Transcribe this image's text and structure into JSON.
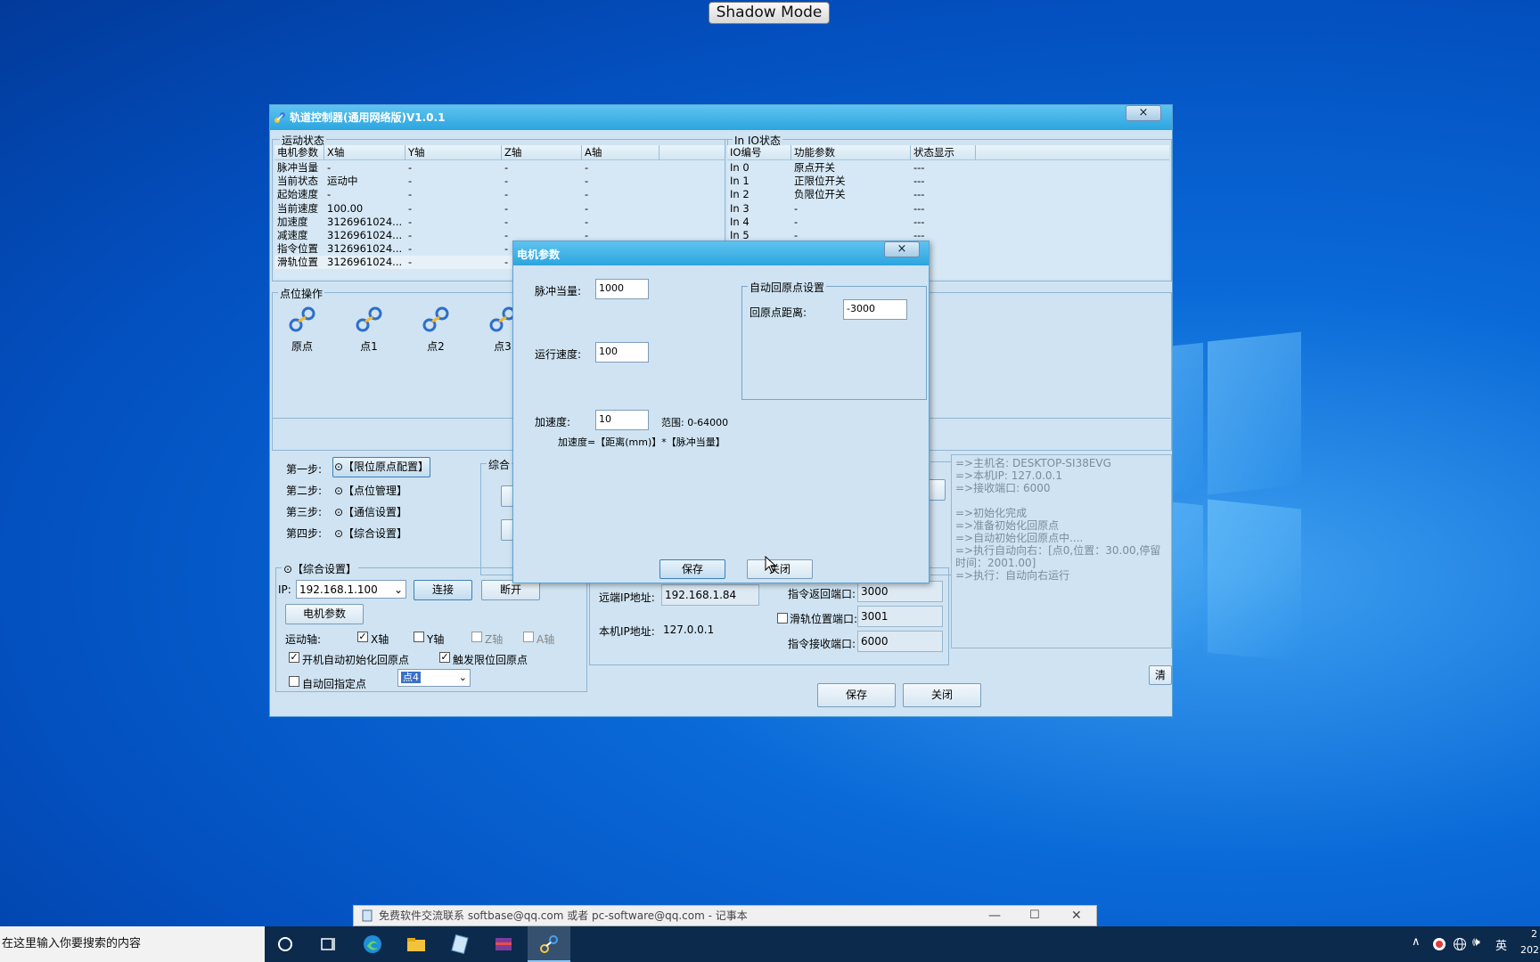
{
  "shadow_mode": "Shadow Mode",
  "main_window": {
    "title": "轨道控制器(通用网络版)V1.0.1",
    "close": "×"
  },
  "motion_status": {
    "title": "运动状态",
    "headers": [
      "电机参数",
      "X轴",
      "Y轴",
      "Z轴",
      "A轴"
    ],
    "rows": [
      [
        "脉冲当量",
        "-",
        "-",
        "-",
        "-"
      ],
      [
        "当前状态",
        "运动中",
        "-",
        "-",
        "-"
      ],
      [
        "起始速度",
        "-",
        "-",
        "-",
        "-"
      ],
      [
        "当前速度",
        "100.00",
        "-",
        "-",
        "-"
      ],
      [
        "加速度",
        "3126961024...",
        "-",
        "-",
        "-"
      ],
      [
        "减速度",
        "3126961024...",
        "-",
        "-",
        "-"
      ],
      [
        "指令位置",
        "3126961024...",
        "-",
        "-",
        "-"
      ],
      [
        "滑轨位置",
        "3126961024...",
        "-",
        "-",
        "-"
      ]
    ]
  },
  "io_status": {
    "title": "In IO状态",
    "headers": [
      "IO编号",
      "功能参数",
      "状态显示"
    ],
    "rows": [
      [
        "In 0",
        "原点开关",
        "---"
      ],
      [
        "In 1",
        "正限位开关",
        "---"
      ],
      [
        "In 2",
        "负限位开关",
        "---"
      ],
      [
        "In 3",
        "-",
        "---"
      ],
      [
        "In 4",
        "-",
        "---"
      ],
      [
        "In 5",
        "-",
        "---"
      ],
      [
        "",
        "",
        "---"
      ],
      [
        "",
        "",
        "---"
      ]
    ]
  },
  "point_ops": {
    "title": "点位操作",
    "points": [
      "原点",
      "点1",
      "点2",
      "点3"
    ]
  },
  "steps": {
    "step1": "第一步:",
    "step1_btn": "⊙【限位原点配置】",
    "step2": "第二步:",
    "step2_btn": "⊙【点位管理】",
    "step3": "第三步:",
    "step3_btn": "⊙【通信设置】",
    "step4": "第四步:",
    "step4_btn": "⊙【综合设置】",
    "partial_group": "综合"
  },
  "general": {
    "title": "⊙【综合设置】",
    "ip_label": "IP:",
    "ip_value": "192.168.1.100",
    "connect": "连接",
    "disconnect": "断开",
    "motor_params": "电机参数",
    "axis_label": "运动轴:",
    "axes": [
      "X轴",
      "Y轴",
      "Z轴",
      "A轴"
    ],
    "auto_init": "开机自动初始化回原点",
    "limit_home": "触发限位回原点",
    "auto_point": "自动回指定点",
    "point_value": "点4"
  },
  "comm": {
    "remote_ip_label": "远端IP地址:",
    "remote_ip": "192.168.1.84",
    "local_ip_label": "本机IP地址:",
    "local_ip": "127.0.0.1",
    "return_port_label": "指令返回端口:",
    "return_port": "3000",
    "rail_port_label": "滑轨位置端口:",
    "rail_port": "3001",
    "recv_port_label": "指令接收端口:",
    "recv_port": "6000",
    "save": "保存",
    "close": "关闭"
  },
  "log": {
    "lines": [
      "=>主机名: DESKTOP-SI38EVG",
      "=>本机IP: 127.0.0.1",
      "=>接收端口: 6000",
      "",
      "=>初始化完成",
      "=>准备初始化回原点",
      "=>自动初始化回原点中....",
      "=>执行自动向右：[点0,位置：30.00,停留时间：2001.00]",
      "=>执行：自动向右运行"
    ],
    "clear": "清"
  },
  "dialog": {
    "title": "电机参数",
    "close": "×",
    "pulse_label": "脉冲当量:",
    "pulse_value": "1000",
    "speed_label": "运行速度:",
    "speed_value": "100",
    "accel_label": "加速度:",
    "accel_value": "10",
    "range": "范围: 0-64000",
    "formula": "加速度=【距离(mm)】*【脉冲当量】",
    "home_group": "自动回原点设置",
    "home_label": "回原点距离:",
    "home_value": "-3000",
    "save": "保存",
    "close_btn": "关闭"
  },
  "notepad": {
    "title": "免费软件交流联系 softbase@qq.com 或者 pc-software@qq.com - 记事本"
  },
  "taskbar": {
    "search": "在这里输入你要搜索的内容",
    "ime": "英",
    "clock_top": "2",
    "clock_bottom": "202"
  }
}
